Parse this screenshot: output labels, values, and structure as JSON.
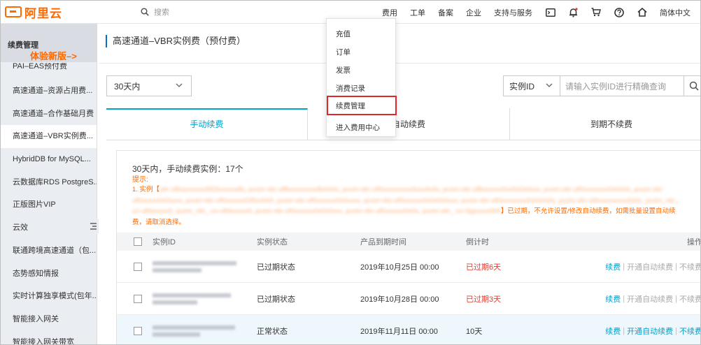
{
  "topbar": {
    "logo_text": "阿里云",
    "search_placeholder": "搜索",
    "nav": [
      "费用",
      "工单",
      "备案",
      "企业",
      "支持与服务"
    ],
    "language": "简体中文",
    "icons": [
      "terminal-icon",
      "bell-icon",
      "cart-icon",
      "help-icon",
      "home-icon"
    ]
  },
  "sidebar": {
    "title": "续费管理",
    "promo": "体验新版–>",
    "partial_item": "PAI–EAS预付费",
    "items": [
      "高速通道–资源占用费...",
      "高速通道–合作基础月费",
      "高速通道–VBR实例费...",
      "HybridDB for MySQL...",
      "云数据库RDS PostgreS...",
      "正版图片VIP",
      "云效",
      "联通跨境高速通道（包...",
      "态势感知情报",
      "实时计算独享模式(包年...",
      "智能接入网关",
      "智能接入网关带宽"
    ],
    "active_index": 2
  },
  "main": {
    "page_title": "高速通道–VBR实例费（预付费）",
    "period_select": "30天内",
    "instance_select": "实例ID",
    "instance_placeholder": "请输入实例ID进行精确查询",
    "tabs": [
      "手动续费",
      "自动续费",
      "到期不续费"
    ],
    "summary": "30天内，手动续费实例：17个",
    "hint_label": "提示:",
    "notice_prefix": "1. 实例【",
    "notice_suffix": "】已过期，不允许设置/修改自动续费，如需批量设置自动续费，请取消选择。",
    "columns": [
      "实例ID",
      "实例状态",
      "产品到期时间",
      "倒计时",
      "操作"
    ],
    "rows": [
      {
        "status": "已过期状态",
        "expire": "2019年10月25日 00:00",
        "countdown": "已过期6天",
        "countdown_red": true
      },
      {
        "status": "已过期状态",
        "expire": "2019年10月28日 00:00",
        "countdown": "已过期3天",
        "countdown_red": true
      },
      {
        "status": "正常状态",
        "expire": "2019年11月11日 00:00",
        "countdown": "10天",
        "countdown_red": false
      }
    ],
    "ops": {
      "renew": "续费",
      "auto": "开通自动续费",
      "no_renew": "不续费",
      "sep": "|"
    }
  },
  "dropdown": {
    "items": [
      "充值",
      "订单",
      "发票",
      "消费记录",
      "续费管理",
      "进入费用中心"
    ],
    "highlighted_index": 4
  },
  "colors": {
    "brand": "#ff6a00",
    "accent": "#00a2ca",
    "highlight_box": "#e3262b",
    "expired": "#e53a2e"
  }
}
